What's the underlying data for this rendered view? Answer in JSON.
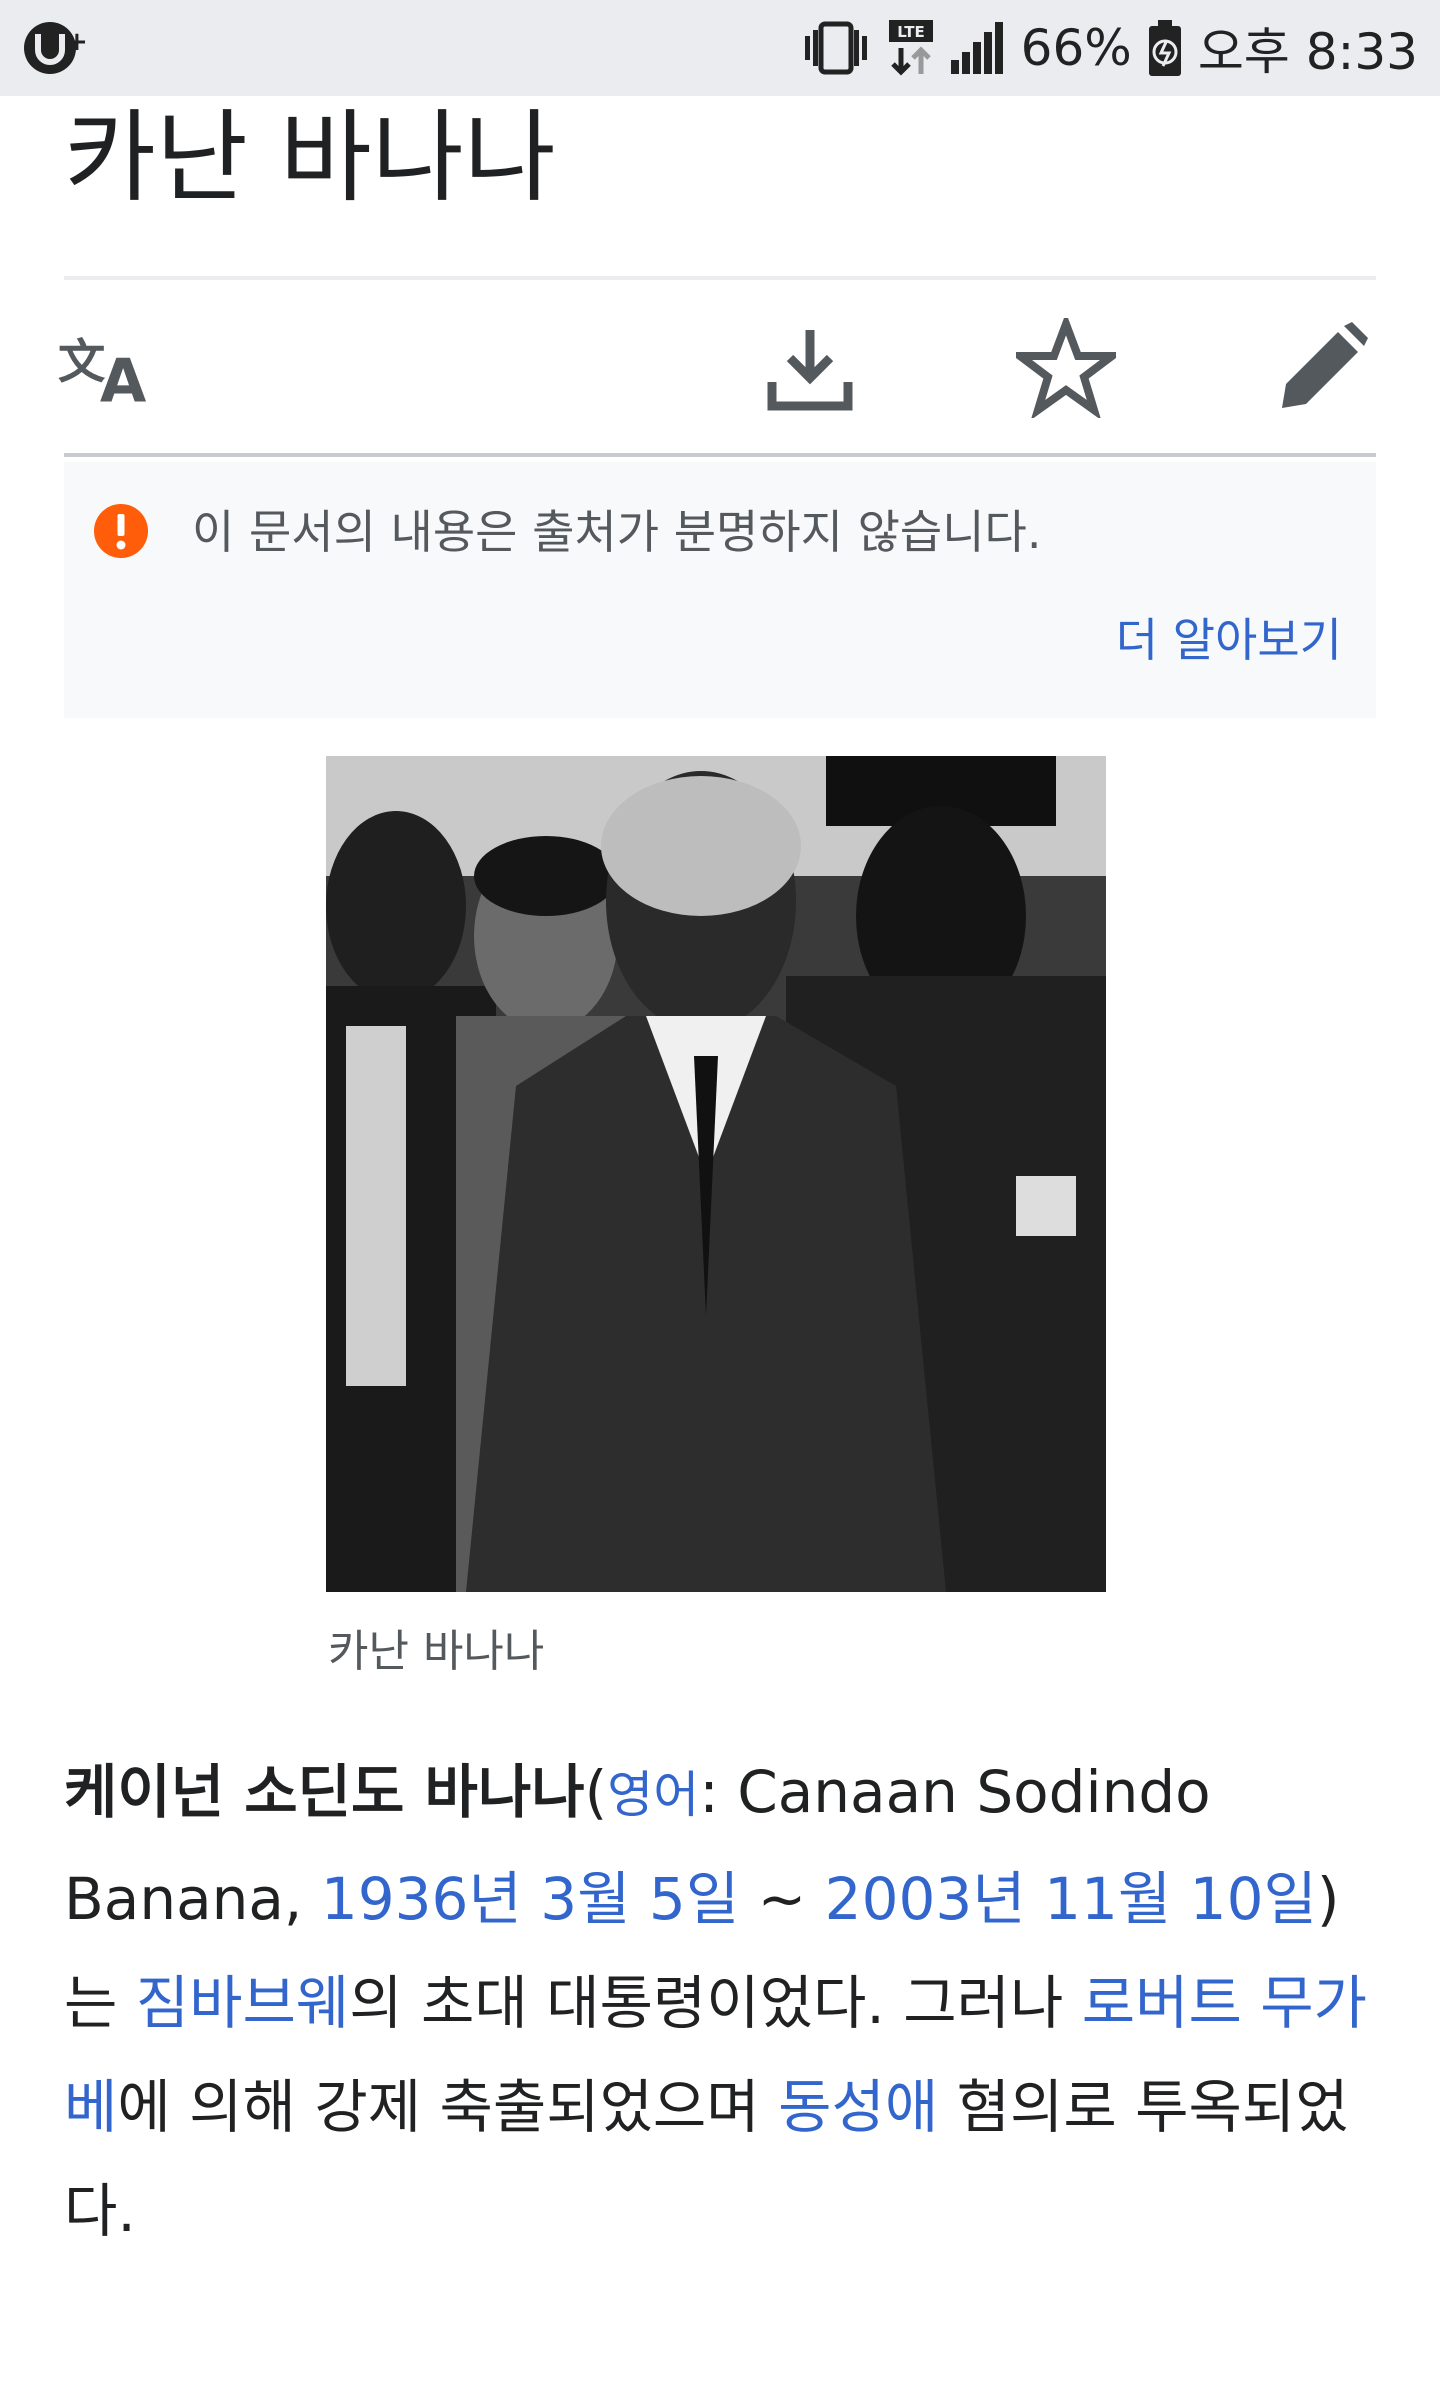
{
  "status_bar": {
    "app_icon": "u-plus-app-icon",
    "battery": "66%",
    "time": "오후 8:33",
    "icons": [
      "vibrate-icon",
      "lte-icon",
      "signal-icon",
      "battery-charging-icon"
    ],
    "lte_label": "LTE"
  },
  "article": {
    "title": "카난 바나나",
    "toolbar": {
      "icons": [
        "translate-icon",
        "download-icon",
        "star-icon",
        "edit-icon"
      ]
    },
    "notice": {
      "icon": "exclamation-icon",
      "text": "이 문서의 내용은 출처가 분명하지 않습니다.",
      "link": "더 알아보기"
    },
    "image_caption": "카난 바나나",
    "lead": {
      "name_bold": "케이넌 소딘도 바나나",
      "open_paren": "(",
      "lang_link": "영어",
      "lang_sep": ": Canaan Sodindo Banana, ",
      "birth_link": "1936년 3월 5일",
      "tilde": " ~ ",
      "death_link": "2003년 11월 10일",
      "close_paren": ")",
      "t1": "는 ",
      "country_link": "짐바브웨",
      "t2": "의 초대 대통령이었다. 그러나 ",
      "person_link": "로버트 무가베",
      "t3": "에 의해 강제 축출되었으며 ",
      "topic_link": "동성애",
      "t4": " 혐의로 투옥되었다."
    }
  },
  "colors": {
    "link": "#3366cc",
    "status_bar_bg": "#eaecf0",
    "notice_bg": "#f8f9fa",
    "warning": "#ff5d0a",
    "icon": "#54595d"
  }
}
